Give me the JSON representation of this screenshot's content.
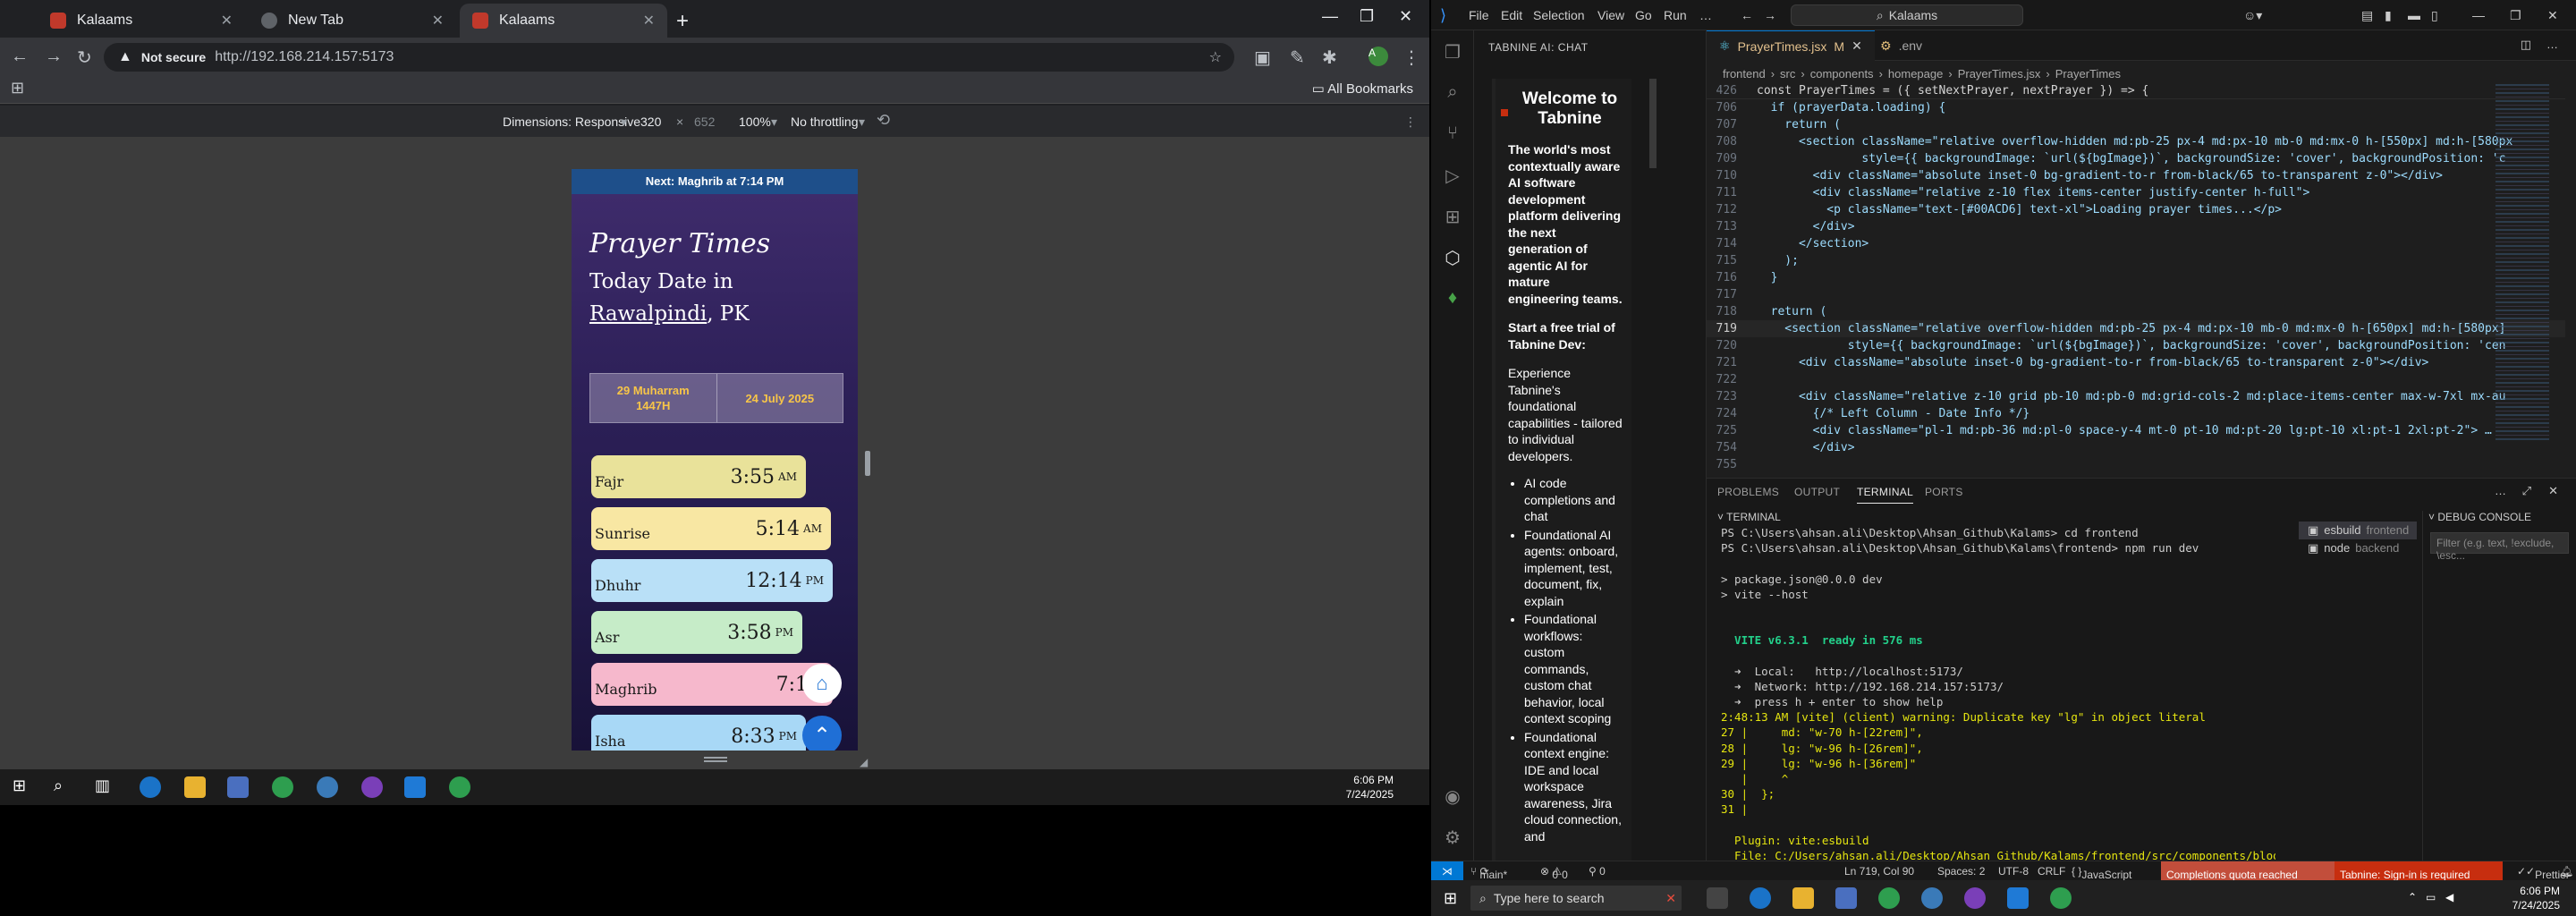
{
  "chrome": {
    "tabs": [
      {
        "title": "Kalaams"
      },
      {
        "title": "New Tab"
      },
      {
        "title": "Kalaams"
      }
    ],
    "security_label": "Not secure",
    "url": "http://192.168.214.157:5173",
    "all_bookmarks": "All Bookmarks",
    "devtools": {
      "dimensions_label": "Dimensions: Responsive",
      "width": "320",
      "height": "652",
      "zoom": "100%",
      "throttle": "No throttling"
    }
  },
  "app": {
    "next_banner": "Next: Maghrib at 7:14 PM",
    "title": "Prayer Times",
    "subtitle_line1": "Today Date in",
    "city": "Rawalpindi",
    "country": ", PK",
    "hijri_line1": "29 Muharram",
    "hijri_line2": "1447H",
    "gregorian": "24 July 2025",
    "prayers": [
      {
        "name": "Fajr",
        "time": "3:55",
        "ampm": "AM",
        "color": "#e9e29a"
      },
      {
        "name": "Sunrise",
        "time": "5:14",
        "ampm": "AM",
        "color": "#f8e7a3"
      },
      {
        "name": "Dhuhr",
        "time": "12:14",
        "ampm": "PM",
        "color": "#b9e0f7"
      },
      {
        "name": "Asr",
        "time": "3:58",
        "ampm": "PM",
        "color": "#c6ecc8"
      },
      {
        "name": "Maghrib",
        "time": "7:14",
        "ampm": "",
        "color": "#f6b8cc"
      },
      {
        "name": "Isha",
        "time": "8:33",
        "ampm": "PM",
        "color": "#a8d8f6"
      }
    ]
  },
  "left_clock": {
    "time": "6:06 PM",
    "date": "7/24/2025"
  },
  "vscode": {
    "menu": [
      "File",
      "Edit",
      "Selection",
      "View",
      "Go",
      "Run"
    ],
    "search": "Kalaams",
    "chat_header": "TABNINE AI: CHAT",
    "chat": {
      "heading": "Welcome to Tabnine",
      "intro": "The world's most contextually aware AI software development platform delivering the next generation of agentic AI for mature engineering teams.",
      "trial": "Start a free trial of Tabnine Dev:",
      "experience": "Experience Tabnine's foundational capabilities - tailored to individual developers.",
      "bullets": [
        "AI code completions and chat",
        "Foundational AI agents: onboard, implement, test, document, fix, explain",
        "Foundational workflows: custom commands, custom chat behavior, local context scoping",
        "Foundational context engine: IDE and local workspace awareness, Jira cloud connection, and"
      ]
    },
    "tabs": [
      {
        "label": "PrayerTimes.jsx",
        "badge": "M"
      },
      {
        "label": ".env",
        "badge": ""
      }
    ],
    "breadcrumb": [
      "frontend",
      "src",
      "components",
      "homepage",
      "PrayerTimes.jsx",
      "PrayerTimes"
    ],
    "sticky_line": {
      "num": "426",
      "text": "const PrayerTimes = ({ setNextPrayer, nextPrayer }) => {"
    },
    "code_lines": [
      {
        "num": "706",
        "text": "  if (prayerData.loading) {"
      },
      {
        "num": "707",
        "text": "    return ("
      },
      {
        "num": "708",
        "text": "      <section className=\"relative overflow-hidden md:pb-25 px-4 md:px-10 mb-0 md:mx-0 h-[550px] md:h-[580px"
      },
      {
        "num": "709",
        "text": "               style={{ backgroundImage: `url(${bgImage})`, backgroundSize: 'cover', backgroundPosition: 'c"
      },
      {
        "num": "710",
        "text": "        <div className=\"absolute inset-0 bg-gradient-to-r from-black/65 to-transparent z-0\"></div>"
      },
      {
        "num": "711",
        "text": "        <div className=\"relative z-10 flex items-center justify-center h-full\">"
      },
      {
        "num": "712",
        "text": "          <p className=\"text-[#00ACD6] text-xl\">Loading prayer times...</p>"
      },
      {
        "num": "713",
        "text": "        </div>"
      },
      {
        "num": "714",
        "text": "      </section>"
      },
      {
        "num": "715",
        "text": "    );"
      },
      {
        "num": "716",
        "text": "  }"
      },
      {
        "num": "717",
        "text": ""
      },
      {
        "num": "718",
        "text": "  return ("
      },
      {
        "num": "719",
        "text": "    <section className=\"relative overflow-hidden md:pb-25 px-4 md:px-10 mb-0 md:mx-0 h-[650px] md:h-[580px]"
      },
      {
        "num": "720",
        "text": "             style={{ backgroundImage: `url(${bgImage})`, backgroundSize: 'cover', backgroundPosition: 'cen"
      },
      {
        "num": "721",
        "text": "      <div className=\"absolute inset-0 bg-gradient-to-r from-black/65 to-transparent z-0\"></div>"
      },
      {
        "num": "722",
        "text": ""
      },
      {
        "num": "723",
        "text": "      <div className=\"relative z-10 grid pb-10 md:pb-0 md:grid-cols-2 md:place-items-center max-w-7xl mx-au"
      },
      {
        "num": "724",
        "text": "        {/* Left Column - Date Info */}"
      },
      {
        "num": "725",
        "text": "        <div className=\"pl-1 md:pb-36 md:pl-0 space-y-4 mt-0 pt-10 md:pt-20 lg:pt-10 xl:pt-1 2xl:pt-2\"> …"
      },
      {
        "num": "754",
        "text": "        </div>"
      },
      {
        "num": "755",
        "text": ""
      }
    ],
    "panel_tabs": [
      "PROBLEMS",
      "OUTPUT",
      "TERMINAL",
      "PORTS"
    ],
    "terminal_header": "TERMINAL",
    "terminal_lines": [
      "PS C:\\Users\\ahsan.ali\\Desktop\\Ahsan_Github\\Kalams> cd frontend",
      "PS C:\\Users\\ahsan.ali\\Desktop\\Ahsan_Github\\Kalams\\frontend> npm run dev",
      "",
      "> package.json@0.0.0 dev",
      "> vite --host",
      "",
      "",
      "  VITE v6.3.1  ready in 576 ms",
      "",
      "  ➜  Local:   http://localhost:5173/",
      "  ➜  Network: http://192.168.214.157:5173/",
      "  ➜  press h + enter to show help",
      "2:48:13 AM [vite] (client) warning: Duplicate key \"lg\" in object literal",
      "27 |     md: \"w-70 h-[22rem]\",",
      "28 |     lg: \"w-96 h-[26rem]\",",
      "29 |     lg: \"w-96 h-[36rem]\"",
      "   |     ^",
      "30 |  };",
      "31 |",
      "",
      "  Plugin: vite:esbuild",
      "  File: C:/Users/ahsan.ali/Desktop/Ahsan_Github/Kalams/frontend/src/components/blogs/Im"
    ],
    "terminal_instances": [
      {
        "name": "esbuild",
        "cwd": "frontend"
      },
      {
        "name": "node",
        "cwd": "backend"
      }
    ],
    "debug_header": "DEBUG CONSOLE",
    "debug_filter_placeholder": "Filter (e.g. text, !exclude, \\esc...",
    "status": {
      "branch": "main*",
      "errors": "0",
      "warnings": "0",
      "cursor": "Ln 719, Col 90",
      "spaces": "Spaces: 2",
      "encoding": "UTF-8",
      "eol": "CRLF",
      "language": "JavaScript JSX",
      "quota": "Completions quota reached",
      "tabnine": "Tabnine: Sign-in is required",
      "prettier": "Prettier"
    }
  },
  "taskbar": {
    "search_placeholder": "Type here to search",
    "time": "6:06 PM",
    "date": "7/24/2025"
  }
}
